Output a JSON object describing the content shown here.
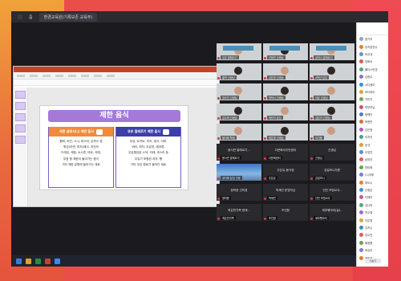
{
  "window": {
    "app_label": "줌",
    "tab_title": "환경교육원(기록보존 교육주)"
  },
  "presentation": {
    "slide_title": "제한 음식",
    "left_column": {
      "header": "제한 삼대식(고 제한 음식",
      "text": "햄버, 치킨, 스시, 파스타, 돈까스 등\n튀김(라면, 피자)에서, 치킨라\n드레싱, 케첩, 소스류, 마요, 카레,\n부침 중 제한이 돌아가는 음식\n기타 제한 분명에 들어가는 재료"
    },
    "right_column": {
      "header": "유유 알레르기 제한 음식",
      "text": "우유, 요거트, 치즈, 생크, 아포,\n버터, 피자, 우유맛, 제과류,\n우유함유된 스낵, 카레, 과스리 등\n우유가 포함된 과자, 빵\n기타 우유 원료가 들어간 재료"
    }
  },
  "video_grid": [
    {
      "caption": "우유 알레르기",
      "kind": "video"
    },
    {
      "caption": "이정민 선생님",
      "kind": "video"
    },
    {
      "caption": "유하나 알레르기",
      "kind": "video"
    },
    {
      "caption": "통학 선생님",
      "kind": "video"
    },
    {
      "caption": "강은영 선생님",
      "kind": "video"
    },
    {
      "caption": "4학년 담임",
      "kind": "video"
    },
    {
      "caption": "강수진 선생님",
      "kind": "video"
    },
    {
      "caption": "박하나 선생님",
      "kind": "video"
    },
    {
      "caption": "이유 선생님",
      "kind": "video"
    },
    {
      "caption": "김수희 선생님",
      "kind": "video"
    },
    {
      "caption": "최민지 담임",
      "kind": "video"
    },
    {
      "caption": "김은지 선생님",
      "kind": "video"
    },
    {
      "caption": "윤다희 학생",
      "kind": "video"
    },
    {
      "caption": "정은영 선생님",
      "kind": "video"
    },
    {
      "caption": "이가윤",
      "kind": "video"
    },
    {
      "name": "윤서연 알레르기...",
      "caption": "윤서연 알레르기",
      "kind": "name"
    },
    {
      "name": "다문화이주민센터",
      "caption": "다문화센터",
      "kind": "name"
    },
    {
      "name": "선생님",
      "caption": "선생님",
      "kind": "name"
    },
    {
      "caption": "장이레 담임 선생",
      "kind": "sky"
    },
    {
      "name": "주은유-음식영",
      "caption": "주은유",
      "kind": "name"
    },
    {
      "name": "김일모니지원",
      "caption": "김일모니",
      "kind": "name"
    },
    {
      "name": "정하윤 선미경",
      "caption": "정하윤",
      "kind": "name"
    },
    {
      "name": "박세린 운영자님",
      "caption": "박세린",
      "kind": "name"
    },
    {
      "name": "인천 모범교사..",
      "caption": "인천 모범교사",
      "kind": "name"
    },
    {
      "name": "최은빈가족 한재...",
      "caption": "최은빈가족",
      "kind": "name"
    },
    {
      "name": "조인환",
      "caption": "조인환",
      "kind": "name"
    },
    {
      "name": "세부행아리(삶)..",
      "caption": "세부행아리",
      "kind": "name"
    }
  ],
  "participants": [
    {
      "name": "참가자",
      "color": "#9aa0b4"
    },
    {
      "name": "공지양연수",
      "color": "#e37e35"
    },
    {
      "name": "하주대",
      "color": "#6c8ecf"
    },
    {
      "name": "장희숙",
      "color": "#d85b5b"
    },
    {
      "name": "폴더스빈영",
      "color": "#5aa67a"
    },
    {
      "name": "김현수",
      "color": "#8d6fd1"
    },
    {
      "name": "서다정미",
      "color": "#3c92c9"
    },
    {
      "name": "포다와티",
      "color": "#e1a23b"
    },
    {
      "name": "거리진",
      "color": "#7aa34a"
    },
    {
      "name": "학부모님",
      "color": "#c9507d"
    },
    {
      "name": "정예진",
      "color": "#4f7ec2"
    },
    {
      "name": "박현민",
      "color": "#de6a3c"
    },
    {
      "name": "김인영",
      "color": "#a45fd0"
    },
    {
      "name": "이자진",
      "color": "#3fa48f"
    },
    {
      "name": "송규",
      "color": "#d0a142"
    },
    {
      "name": "주영진",
      "color": "#5e8bd8"
    },
    {
      "name": "남여진",
      "color": "#d86060"
    },
    {
      "name": "방미희",
      "color": "#6aa54f"
    },
    {
      "name": "(1)국제",
      "color": "#7a7fcf"
    },
    {
      "name": "포도수",
      "color": "#e2813b"
    },
    {
      "name": "신정은",
      "color": "#4d8fc6"
    },
    {
      "name": "이예지",
      "color": "#c75b8f"
    },
    {
      "name": "강나린",
      "color": "#56a67c"
    },
    {
      "name": "전수정",
      "color": "#9c6ad1"
    },
    {
      "name": "이은영",
      "color": "#e0a03c"
    },
    {
      "name": "임지수",
      "color": "#4a84c8"
    },
    {
      "name": "장수민",
      "color": "#d95c5c"
    },
    {
      "name": "배정원",
      "color": "#62a25a"
    },
    {
      "name": "최성우",
      "color": "#8678cf"
    },
    {
      "name": "권민지",
      "color": "#dd7a3a"
    }
  ],
  "panel_button": "더보기",
  "colors": {
    "slide_title_bg": "#a479d8",
    "left_header": "#f08a3a",
    "right_header": "#3b3fa8",
    "background": "#e94e48"
  }
}
